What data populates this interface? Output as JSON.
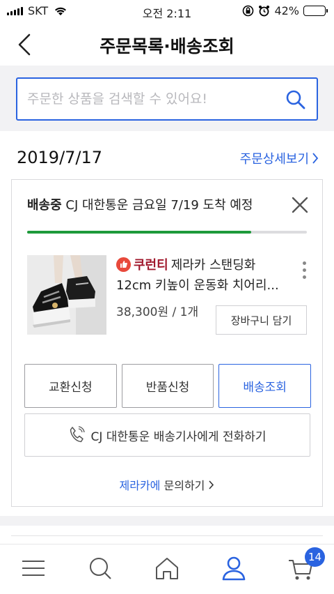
{
  "status_bar": {
    "carrier": "SKT",
    "time": "오전 2:11",
    "battery": "42%",
    "battery_level": 0.42
  },
  "header": {
    "title": "주문목록·배송조회"
  },
  "search": {
    "placeholder": "주문한 상품을 검색할 수 있어요!",
    "value": ""
  },
  "order": {
    "date": "2019/7/17",
    "detail_link": "주문상세보기",
    "delivery": {
      "status": "배송중",
      "message": "CJ 대한통운 금요일 7/19 도착 예정",
      "progress": 0.8
    },
    "product": {
      "brand": "쿠런티",
      "title": "제라카 스탠딩화 12cm 키높이 운동화 치어리...",
      "price": "38,300원 / 1개",
      "cart_button": "장바구니 담기"
    },
    "actions": [
      {
        "label": "교환신청"
      },
      {
        "label": "반품신청"
      },
      {
        "label": "배송조회"
      }
    ],
    "call_button": "CJ 대한통운 배송기사에게 전화하기",
    "inquiry": {
      "seller": "제라카에",
      "label": "문의하기"
    }
  },
  "tab_bar": {
    "cart_count": "14",
    "accent": "#2a63e0"
  },
  "colors": {
    "accent": "#2a63e0",
    "progress": "#1e9a3b",
    "brand": "#a0182c"
  }
}
